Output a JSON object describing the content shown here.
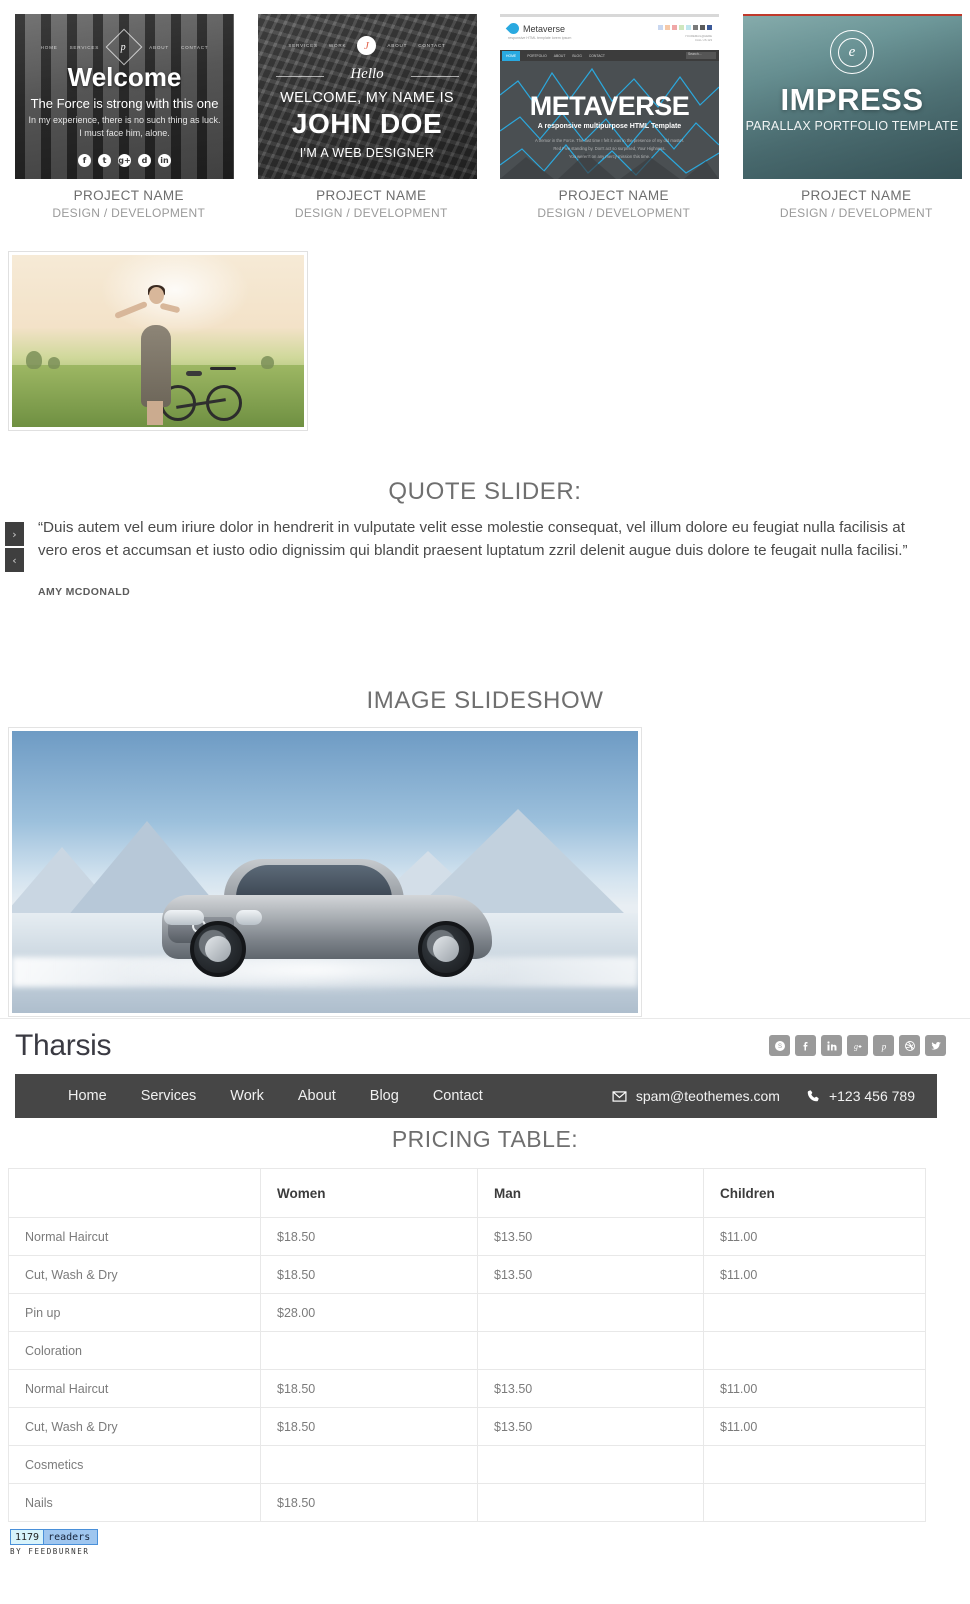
{
  "portfolio": {
    "items": [
      {
        "name": "PROJECT NAME",
        "category": "DESIGN / DEVELOPMENT",
        "preview": {
          "style": "welcome",
          "nav": [
            "HOME",
            "SERVICES",
            "ABOUT",
            "CONTACT"
          ],
          "logo_letter": "p",
          "heading": "Welcome",
          "subheading": "The Force is strong with this one",
          "body_line1": "In my experience, there is no such thing as luck.",
          "body_line2": "I must face him, alone.",
          "socials": [
            "f",
            "t",
            "g+",
            "d",
            "in"
          ]
        }
      },
      {
        "name": "PROJECT NAME",
        "category": "DESIGN / DEVELOPMENT",
        "preview": {
          "style": "johndoe",
          "nav": [
            "SERVICES",
            "WORK",
            "ABOUT",
            "CONTACT"
          ],
          "logo_letter": "J",
          "script": "Hello",
          "intro": "WELCOME, MY NAME IS",
          "name": "JOHN DOE",
          "role": "I'M A WEB DESIGNER"
        }
      },
      {
        "name": "PROJECT NAME",
        "category": "DESIGN / DEVELOPMENT",
        "preview": {
          "style": "metaverse",
          "brand": "Metaverse",
          "tagline": "responsive HTML template lorem ipsum",
          "contact_line1": "YOUREMAIL@HERE",
          "contact_line2": "CALL US 123",
          "nav": [
            "HOME",
            "PORTFOLIO",
            "ABOUT",
            "BLOG",
            "CONTACT"
          ],
          "search_placeholder": "Search...",
          "hero_title": "METAVERSE",
          "hero_sub": "A responsive multipurpose HTML Template",
          "hero_body_line1": "A tremor in the Force. The last time I felt it was in the presence of my old master.",
          "hero_body_line2": "Red Five standing by. Don't act so surprised, Your Highness.",
          "hero_body_line3": "You weren't on any mercy mission this time."
        }
      },
      {
        "name": "PROJECT NAME",
        "category": "DESIGN / DEVELOPMENT",
        "preview": {
          "style": "impress",
          "stamp_letter": "e",
          "title": "IMPRESS",
          "subtitle": "PARALLAX PORTFOLIO TEMPLATE"
        }
      }
    ]
  },
  "single_image": {
    "alt": "woman with arms outstretched beside a bicycle in a field"
  },
  "quote_slider": {
    "title": "QUOTE SLIDER:",
    "next_label": "›",
    "prev_label": "‹",
    "quote": "“Duis autem vel eum iriure dolor in hendrerit in vulputate velit esse molestie consequat, vel illum dolore eu feugiat nulla facilisis at vero eros et accumsan et iusto odio dignissim qui blandit praesent luptatum zzril delenit augue duis dolore te feugait nulla facilisi.”",
    "author": "AMY MCDONALD"
  },
  "slideshow": {
    "title": "IMAGE SLIDESHOW",
    "alt": "silver sedan driving on a snowy mountain road"
  },
  "site_header": {
    "logo": "Tharsis",
    "socials": [
      {
        "name": "skype-icon",
        "label": "Skype"
      },
      {
        "name": "facebook-icon",
        "label": "Facebook"
      },
      {
        "name": "linkedin-icon",
        "label": "LinkedIn"
      },
      {
        "name": "googleplus-icon",
        "label": "Google Plus"
      },
      {
        "name": "pinterest-icon",
        "label": "Pinterest"
      },
      {
        "name": "dribbble-icon",
        "label": "Dribbble"
      },
      {
        "name": "twitter-icon",
        "label": "Twitter"
      }
    ]
  },
  "nav": {
    "links": [
      "Home",
      "Services",
      "Work",
      "About",
      "Blog",
      "Contact"
    ],
    "email": "spam@teothemes.com",
    "phone": "+123 456 789"
  },
  "pricing": {
    "title": "PRICING TABLE:",
    "headers": [
      "",
      "Women",
      "Man",
      "Children"
    ],
    "rows": [
      [
        "Normal Haircut",
        "$18.50",
        "$13.50",
        "$11.00"
      ],
      [
        "Cut, Wash & Dry",
        "$18.50",
        "$13.50",
        "$11.00"
      ],
      [
        "Pin up",
        "$28.00",
        "",
        ""
      ],
      [
        "Coloration",
        "",
        "",
        ""
      ],
      [
        "Normal Haircut",
        "$18.50",
        "$13.50",
        "$11.00"
      ],
      [
        "Cut, Wash & Dry",
        "$18.50",
        "$13.50",
        "$11.00"
      ],
      [
        "Cosmetics",
        "",
        "",
        ""
      ],
      [
        "Nails",
        "$18.50",
        "",
        ""
      ]
    ]
  },
  "feedburner": {
    "count": "1179",
    "word": "readers",
    "attribution": "BY FEEDBURNER"
  },
  "colors": {
    "nav_bg": "#464646",
    "heading": "#6f6f6f",
    "social_btn": "#9a9a9a",
    "accent_blue": "#29a9e0",
    "feed_blue": "#9fc6ef"
  }
}
